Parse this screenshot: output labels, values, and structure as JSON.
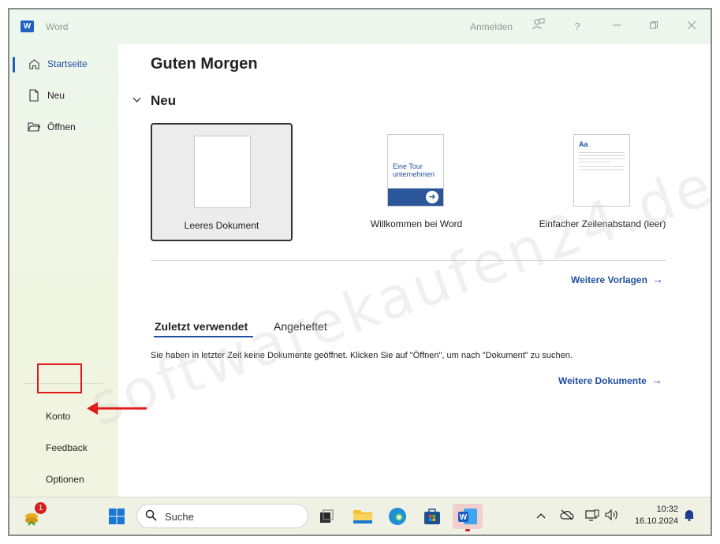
{
  "window": {
    "app_name": "Word",
    "signin_label": "Anmelden",
    "help_label": "?"
  },
  "sidebar": {
    "items": [
      {
        "label": "Startseite",
        "icon": "home-icon"
      },
      {
        "label": "Neu",
        "icon": "new-document-icon"
      },
      {
        "label": "Öffnen",
        "icon": "folder-open-icon"
      }
    ],
    "bottom": {
      "account": "Konto",
      "feedback": "Feedback",
      "options": "Optionen"
    }
  },
  "main": {
    "greeting": "Guten Morgen",
    "new_section": "Neu",
    "templates": [
      {
        "name": "Leeres Dokument",
        "selected": true
      },
      {
        "name": "Willkommen bei Word",
        "thumb_text": "Eine Tour unternehmen"
      },
      {
        "name": "Einfacher Zeilenabstand (leer)",
        "thumb_text": "Aa"
      }
    ],
    "more_templates": "Weitere Vorlagen",
    "tabs": [
      "Zuletzt verwendet",
      "Angeheftet"
    ],
    "empty_message": "Sie haben in letzter Zeit keine Dokumente geöffnet. Klicken Sie auf \"Öffnen\", um nach \"Dokument\" zu suchen.",
    "more_documents": "Weitere Dokumente",
    "watermark": "softwarekaufen24.de"
  },
  "taskbar": {
    "search_placeholder": "Suche",
    "badge_count": "1",
    "time": "10:32",
    "date": "16.10.2024"
  },
  "colors": {
    "accent": "#1f4f9e",
    "word_blue": "#2b579a",
    "highlight_red": "#e01a1a"
  }
}
